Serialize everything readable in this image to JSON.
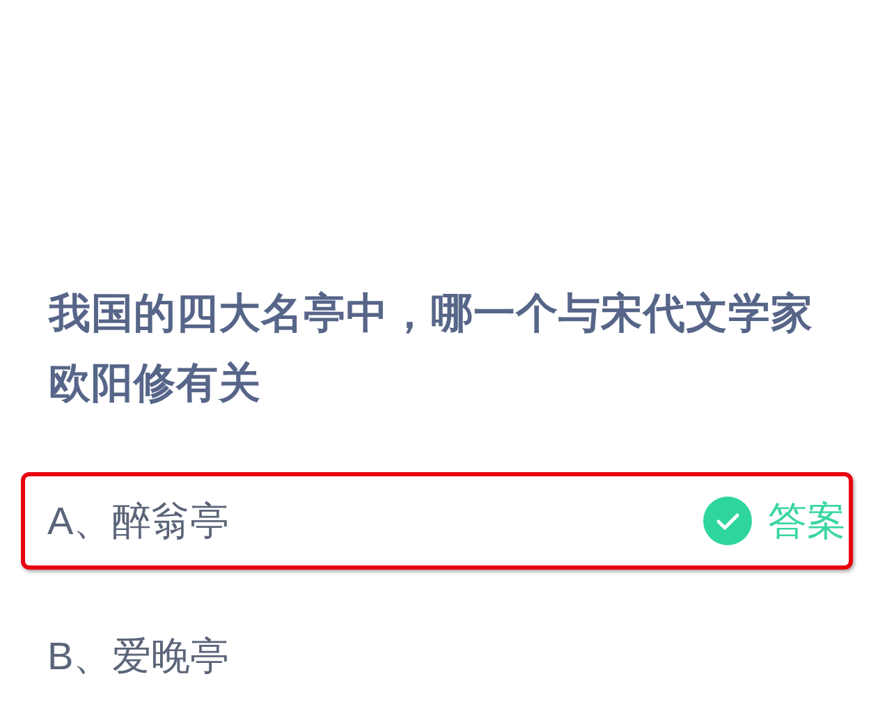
{
  "question": "我国的四大名亭中，哪一个与宋代文学家欧阳修有关",
  "options": [
    {
      "label": "A、醉翁亭",
      "highlighted": true,
      "correct": true,
      "answer_tag": "答案"
    },
    {
      "label": "B、爱晚亭",
      "highlighted": false,
      "correct": false
    }
  ]
}
